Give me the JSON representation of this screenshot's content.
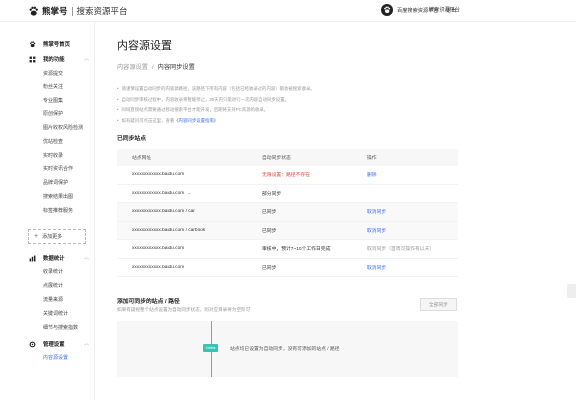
{
  "header": {
    "brand_name": "熊掌号",
    "brand_sub": "搜索资源平台",
    "nav_link": "搜索资源平台",
    "user_name": "百度搜索资源平台",
    "logout": "退出"
  },
  "sidebar": {
    "sections": [
      {
        "label": "熊掌号首页",
        "icon": "paw-icon"
      },
      {
        "label": "我的功能",
        "icon": "grid-icon",
        "items": [
          "资源提交",
          "粉丝关注",
          "专业图集",
          "原创保护",
          "图片收权风险检测",
          "优站检查",
          "实时收录",
          "实时资讯合作",
          "品牌词保护",
          "搜索结果出图",
          "标签推荐服务"
        ]
      },
      {
        "label": "数据统计",
        "icon": "chart-icon",
        "items": [
          "收录统计",
          "点展统计",
          "流量来源",
          "关键词统计",
          "细节与搜索指数"
        ]
      },
      {
        "label": "管理设置",
        "icon": "gear-icon",
        "items": [
          "内容源设置"
        ]
      }
    ],
    "add_more": "添加更多",
    "active_item": "内容源设置"
  },
  "main": {
    "title": "内容源设置",
    "breadcrumb": [
      "内容源设置",
      "内容同步设置"
    ],
    "notes": [
      "请谨慎设置自动同步的内容源路径，该路径下所有内容（包括已经收录过的内容）都会被搜索收录。",
      "自动同步审核过程中，内容收录将暂缓停止，30天内只能进行一次内容自动同步设置。",
      "同域直接站点需要通过移动搜索平台才能开发，后期将支持PC资源的收录。",
      "如有疑问可点击这里，查看"
    ],
    "notes_link": "《内容同步设置指南》",
    "synced_title": "已同步站点",
    "table": {
      "headers": [
        "站点网址",
        "自动同步状态",
        "操作"
      ],
      "rows": [
        {
          "site": "xxxxxxxxxxxx.baidu.com",
          "status": "无限设置：路径不存在",
          "action": "删除"
        },
        {
          "site": "xxxxxxxxxxxx.baidu.com",
          "status": "部分同步",
          "action": ""
        },
        {
          "site": "xxxxxxxxxxxx.baidu.com / car",
          "status": "已同步",
          "action": "取消同步"
        },
        {
          "site": "xxxxxxxxxxxx.baidu.com / carbook",
          "status": "已同步",
          "action": "取消同步"
        },
        {
          "site": "xxxxxxxxxxxx.baidu.com",
          "status": "审核中，预计7~10个工作日完成",
          "action": "取消同步（首周可操作有以天）"
        },
        {
          "site": "xxxxxxxxxxxx.baidu.com",
          "status": "已同步",
          "action": "取消同步"
        }
      ]
    },
    "add_title": "添加可同步的站点 / 路径",
    "add_sub": "如果有疑视整个站点设置为自动同步状态，则对应目录将为空阶可",
    "sync_all_button": "全部同步",
    "badge": "1bbbs",
    "empty_text": "站点均已设置为自动同步，没有可添加的站点 / 路径"
  },
  "colors": {
    "link": "#3a6fe8",
    "error": "#e14b3b",
    "accent": "#35c5b5"
  }
}
